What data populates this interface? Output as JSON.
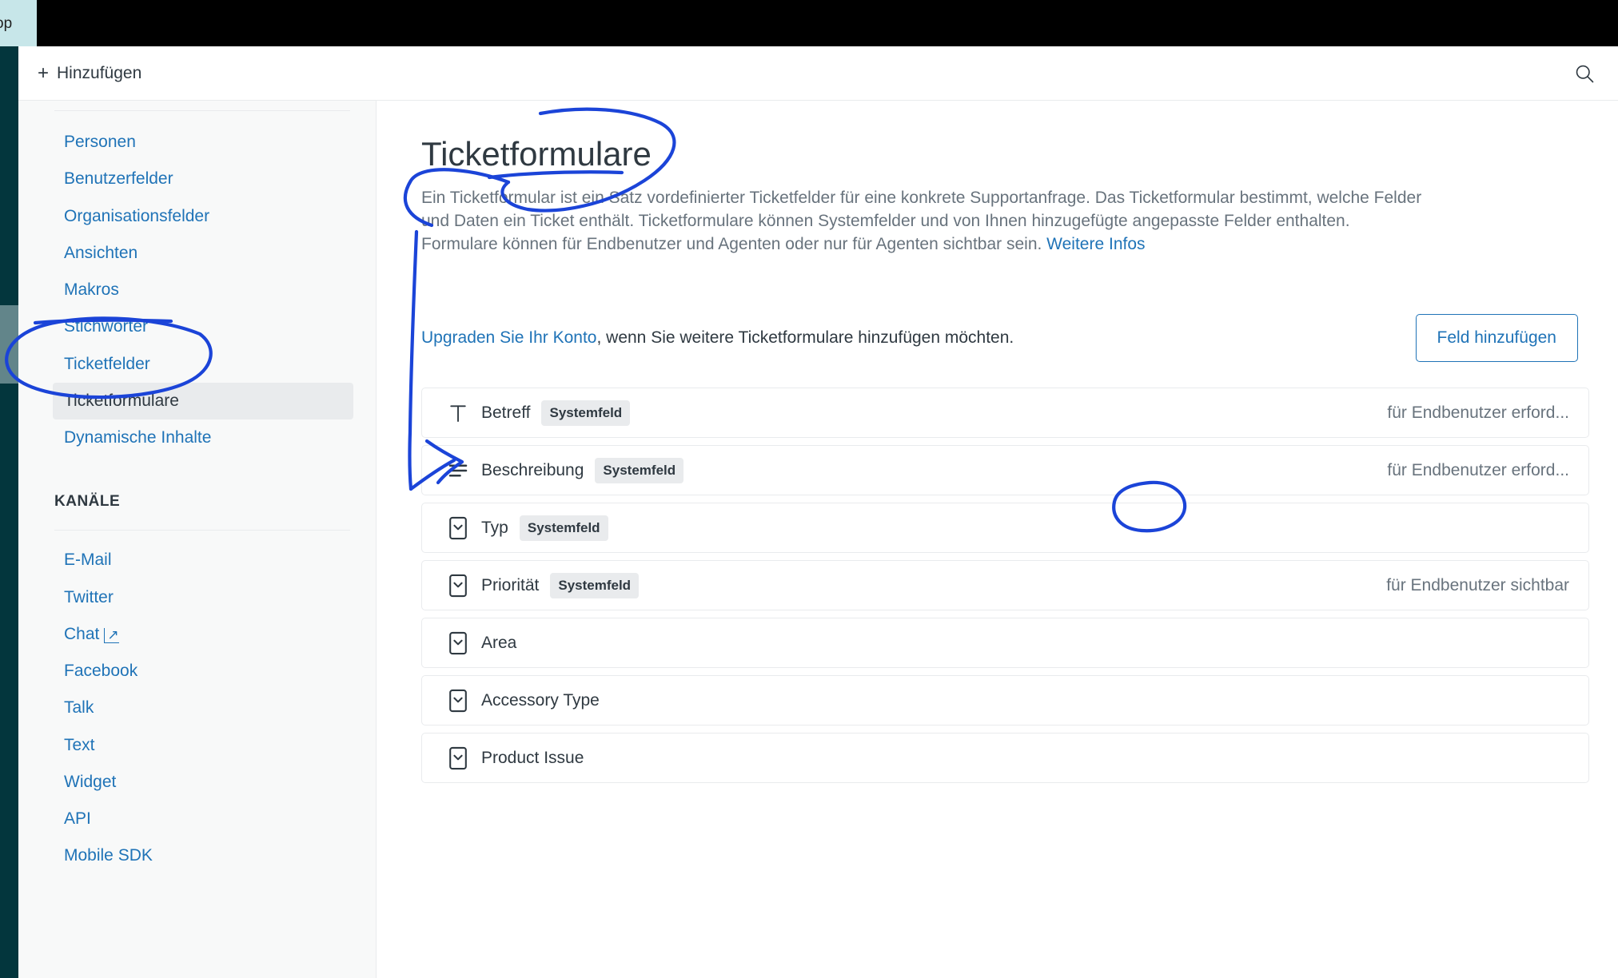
{
  "window": {
    "sliver_text": "op"
  },
  "header": {
    "add_label": "Hinzufügen",
    "plus_icon": "plus-icon",
    "search_icon": "search-icon"
  },
  "sidebar": {
    "items": [
      {
        "label": "Personen",
        "active": false,
        "external": false
      },
      {
        "label": "Benutzerfelder",
        "active": false,
        "external": false
      },
      {
        "label": "Organisationsfelder",
        "active": false,
        "external": false
      },
      {
        "label": "Ansichten",
        "active": false,
        "external": false
      },
      {
        "label": "Makros",
        "active": false,
        "external": false
      },
      {
        "label": "Stichwörter",
        "active": false,
        "external": false
      },
      {
        "label": "Ticketfelder",
        "active": false,
        "external": false
      },
      {
        "label": "Ticketformulare",
        "active": true,
        "external": false
      },
      {
        "label": "Dynamische Inhalte",
        "active": false,
        "external": false
      }
    ],
    "section_title": "KANÄLE",
    "channel_items": [
      {
        "label": "E-Mail",
        "external": false
      },
      {
        "label": "Twitter",
        "external": false
      },
      {
        "label": "Chat",
        "external": true
      },
      {
        "label": "Facebook",
        "external": false
      },
      {
        "label": "Talk",
        "external": false
      },
      {
        "label": "Text",
        "external": false
      },
      {
        "label": "Widget",
        "external": false
      },
      {
        "label": "API",
        "external": false
      },
      {
        "label": "Mobile SDK",
        "external": false
      }
    ]
  },
  "main": {
    "title": "Ticketformulare",
    "description": "Ein Ticketformular ist ein Satz vordefinierter Ticketfelder für eine konkrete Supportanfrage. Das Ticketformular bestimmt, welche Felder und Daten ein Ticket enthält. Ticketformulare können Systemfelder und von Ihnen hinzugefügte angepasste Felder enthalten. Formulare können für Endbenutzer und Agenten oder nur für Agenten sichtbar sein. ",
    "description_link": "Weitere Infos",
    "upgrade_link": "Upgraden Sie Ihr Konto",
    "upgrade_rest": ", wenn Sie weitere Ticketformulare hinzufügen möchten.",
    "add_field_button": "Feld hinzufügen",
    "fields": [
      {
        "name": "Betreff",
        "icon": "text-field-icon",
        "badge": "Systemfeld",
        "status": "für Endbenutzer erford..."
      },
      {
        "name": "Beschreibung",
        "icon": "multiline-text-icon",
        "badge": "Systemfeld",
        "status": "für Endbenutzer erford..."
      },
      {
        "name": "Typ",
        "icon": "dropdown-icon",
        "badge": "Systemfeld",
        "status": ""
      },
      {
        "name": "Priorität",
        "icon": "dropdown-icon",
        "badge": "Systemfeld",
        "status": "für Endbenutzer sichtbar"
      },
      {
        "name": "Area",
        "icon": "dropdown-icon",
        "badge": "",
        "status": ""
      },
      {
        "name": "Accessory Type",
        "icon": "dropdown-icon",
        "badge": "",
        "status": ""
      },
      {
        "name": "Product Issue",
        "icon": "dropdown-icon",
        "badge": "",
        "status": ""
      }
    ]
  },
  "colors": {
    "link": "#1f73b7",
    "text": "#2f3941",
    "muted": "#68737d",
    "rail": "#03363d",
    "annotation": "#1b44d8",
    "sliver": "#c7e6e9"
  }
}
